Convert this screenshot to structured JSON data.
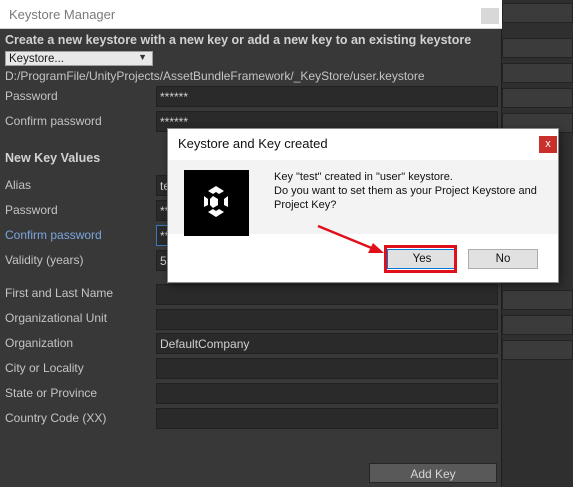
{
  "window": {
    "title": "Keystore Manager"
  },
  "keystore_section": {
    "header": "Create a new keystore with a new key or add a new key to an existing keystore",
    "dropdown_label": "Keystore...",
    "path": "D:/ProgramFile/UnityProjects/AssetBundleFramework/_KeyStore/user.keystore",
    "password_label": "Password",
    "password_value": "******",
    "confirm_label": "Confirm password",
    "confirm_value": "******"
  },
  "key_section": {
    "header": "New Key Values",
    "alias_label": "Alias",
    "alias_value": "te",
    "password_label": "Password",
    "password_value": "**",
    "confirm_label": "Confirm password",
    "confirm_value": "**",
    "validity_label": "Validity (years)",
    "validity_value": "5(",
    "first_last_label": "First and Last Name",
    "first_last_value": "",
    "org_unit_label": "Organizational Unit",
    "org_unit_value": "",
    "organization_label": "Organization",
    "organization_value": "DefaultCompany",
    "city_label": "City or Locality",
    "city_value": "",
    "state_label": "State or Province",
    "state_value": "",
    "country_label": "Country Code (XX)",
    "country_value": "",
    "add_key_label": "Add Key"
  },
  "dialog": {
    "title": "Keystore and Key created",
    "close_glyph": "x",
    "message_line1": "Key \"test\" created in \"user\" keystore.",
    "message_line2": "Do you want to set them as your Project Keystore and",
    "message_line3": "Project Key?",
    "yes_label": "Yes",
    "no_label": "No"
  },
  "background": {
    "partial_text": "e"
  },
  "colors": {
    "highlight": "#e0101a",
    "focus_blue": "#3a79bb",
    "label_blue": "#7ba6e0"
  }
}
